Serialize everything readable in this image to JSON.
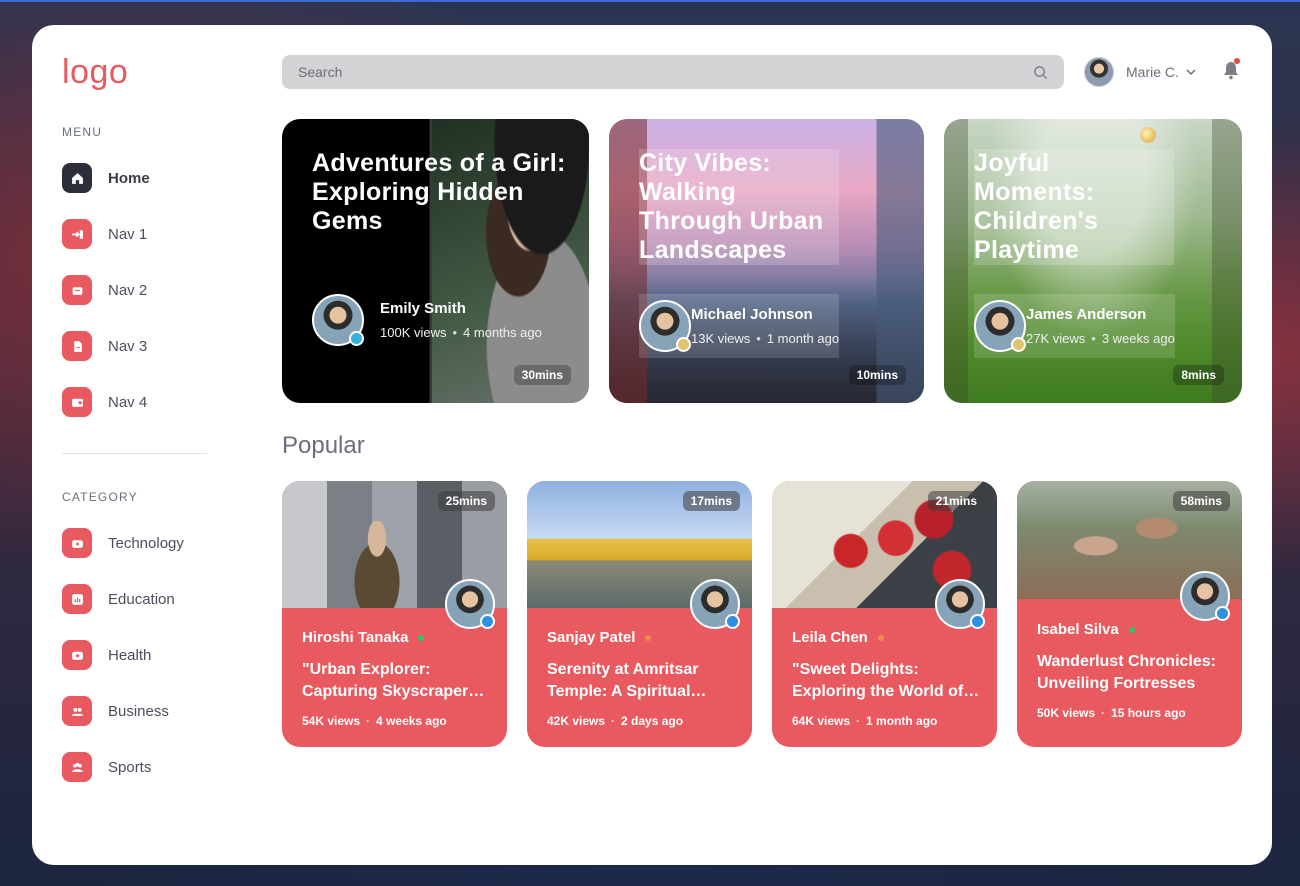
{
  "logo": "logo",
  "sidebar": {
    "menu_title": "MENU",
    "menu": [
      {
        "label": "Home",
        "icon": "home-icon",
        "active": true
      },
      {
        "label": "Nav 1",
        "icon": "login-icon"
      },
      {
        "label": "Nav 2",
        "icon": "inbox-icon"
      },
      {
        "label": "Nav 3",
        "icon": "document-icon"
      },
      {
        "label": "Nav 4",
        "icon": "wallet-icon"
      }
    ],
    "category_title": "CATEGORY",
    "categories": [
      {
        "label": "Technology",
        "icon": "tv-icon"
      },
      {
        "label": "Education",
        "icon": "chart-icon"
      },
      {
        "label": "Health",
        "icon": "health-icon"
      },
      {
        "label": "Business",
        "icon": "users-icon"
      },
      {
        "label": "Sports",
        "icon": "team-icon"
      }
    ]
  },
  "search": {
    "placeholder": "Search"
  },
  "user": {
    "name": "Marie C."
  },
  "featured": [
    {
      "title": "Adventures of a Girl: Exploring Hidden Gems",
      "author": "Emily Smith",
      "views": "100K views",
      "time": "4 months ago",
      "duration": "30mins"
    },
    {
      "title": "City Vibes: Walking Through Urban Landscapes",
      "author": "Michael Johnson",
      "views": "13K views",
      "time": "1 month ago",
      "duration": "10mins"
    },
    {
      "title": "Joyful Moments: Children's Playtime",
      "author": "James Anderson",
      "views": "27K views",
      "time": "3 weeks ago",
      "duration": "8mins"
    }
  ],
  "popular": {
    "title": "Popular",
    "items": [
      {
        "author": "Hiroshi Tanaka",
        "status_color": "#2fc36b",
        "title": "\"Urban Explorer: Capturing Skyscraper Silhouettes\"",
        "views": "54K views",
        "time": "4 weeks ago",
        "duration": "25mins"
      },
      {
        "author": "Sanjay Patel",
        "status_color": "#f08a4b",
        "title": "Serenity at Amritsar Temple: A Spiritual Journey",
        "views": "42K views",
        "time": "2 days ago",
        "duration": "17mins"
      },
      {
        "author": "Leila Chen",
        "status_color": "#f08a4b",
        "title": "\"Sweet Delights: Exploring the World of Strawberries\"",
        "views": "64K views",
        "time": "1 month ago",
        "duration": "21mins"
      },
      {
        "author": "Isabel Silva",
        "status_color": "#2fc36b",
        "title": "Wanderlust Chronicles: Unveiling Fortresses",
        "views": "50K views",
        "time": "15 hours ago",
        "duration": "58mins"
      }
    ]
  },
  "colors": {
    "accent": "#e85a5f",
    "dark": "#2c2f3a"
  }
}
